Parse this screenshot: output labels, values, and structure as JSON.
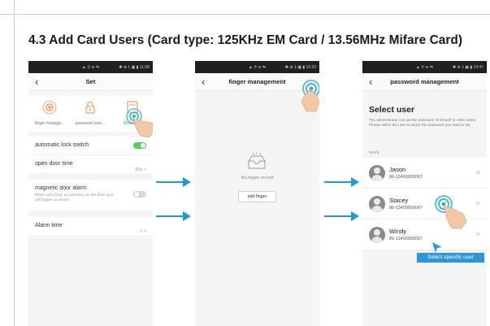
{
  "heading": "4.3 Add Card Users (Card type: 125KHz EM Card / 13.56MHz Mifare Card)",
  "colors": {
    "accent_blue": "#1f9ad6",
    "toggle_green": "#4cd35f",
    "highlight_cyan": "#2fb1d8",
    "tag_blue": "#2d97d9"
  },
  "phone1": {
    "status_center": "▲ ⚲ ≋ ⇆",
    "status_right": "✱ ⊕ ‡ ▣ ▮ 11:08",
    "back_icon": "chevron-left",
    "title": "Set",
    "quick_items": [
      {
        "label": "finger manage...",
        "icon": "fingerprint-icon"
      },
      {
        "label": "password man...",
        "icon": "lock-icon"
      },
      {
        "label": "Door Card",
        "icon": "card-icon"
      }
    ],
    "rows": {
      "auto_lock_label": "automatic lock switch",
      "open_door_label": "open door time",
      "open_door_value": "99s >",
      "magnetic_label": "magnetic door alarm",
      "magnetic_desc": "When unlocked, an intrusion on the door lock will trigger an alarm",
      "alarm_label": "Alarm time",
      "alarm_value": "1 >"
    }
  },
  "phone2": {
    "status_center": "▲ ⚲ ≋ ⇆",
    "status_right": "✱ ⊕ ‡ ▣ ▮ 10:33",
    "back_icon": "chevron-left",
    "title": "finger management",
    "empty_text": "No finger record",
    "add_button": "add finger"
  },
  "phone3": {
    "status_center": "▲ ⚲ ≋ ⇆",
    "status_right": "✱ ⊕ ‡ ▣ ▮ 14:47",
    "back_icon": "chevron-left",
    "title": "password management",
    "select_title": "Select user",
    "select_desc": "The administrator can set the password of himself or other users. Please select the user to whom the password you want to set.",
    "group_label": "family",
    "users": [
      {
        "name": "Jason",
        "phone": "86-13400000067"
      },
      {
        "name": "Stacey",
        "phone": "86-13400000067"
      },
      {
        "name": "Windy",
        "phone": "86-13400000067"
      }
    ],
    "chevron": ">"
  },
  "callout": "Select specific user"
}
